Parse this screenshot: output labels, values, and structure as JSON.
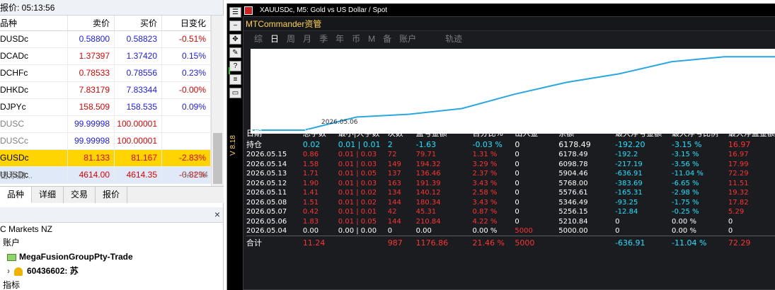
{
  "market_watch": {
    "title": "报价: 05:13:56",
    "headers": {
      "symbol": "品种",
      "bid": "卖价",
      "ask": "买价",
      "change": "日变化"
    },
    "rows": [
      {
        "symbol": "DUSDc",
        "bid": "0.58800",
        "ask": "0.58823",
        "change": "-0.51%",
        "state": ""
      },
      {
        "symbol": "DCADc",
        "bid": "1.37397",
        "ask": "1.37420",
        "change": "0.15%",
        "state": ""
      },
      {
        "symbol": "DCHFc",
        "bid": "0.78533",
        "ask": "0.78556",
        "change": "0.23%",
        "state": ""
      },
      {
        "symbol": "DHKDc",
        "bid": "7.83179",
        "ask": "7.83344",
        "change": "-0.00%",
        "state": ""
      },
      {
        "symbol": "DJPYc",
        "bid": "158.509",
        "ask": "158.535",
        "change": "0.09%",
        "state": ""
      },
      {
        "symbol": "DUSC",
        "bid": "99.99998",
        "ask": "100.00001",
        "change": "",
        "state": "gray"
      },
      {
        "symbol": "DUSCc",
        "bid": "99.99998",
        "ask": "100.00001",
        "change": "",
        "state": "gray"
      },
      {
        "symbol": "GUSDc",
        "bid": "81.133",
        "ask": "81.167",
        "change": "-2.83%",
        "state": "highlight"
      },
      {
        "symbol": "UUSDc",
        "bid": "4614.00",
        "ask": "4614.35",
        "change": "-0.82%",
        "state": "selected"
      }
    ],
    "footer_add": "击添加...",
    "footer_count": "34 / 34",
    "tabs": [
      "品种",
      "详细",
      "交易",
      "报价"
    ]
  },
  "navigator": {
    "broker": "C Markets NZ",
    "accounts_label": "账户",
    "server": "MegaFusionGroupPty-Trade",
    "account": "60436602: 苏",
    "indicators": "指标",
    "close_icon": "close-icon"
  },
  "chart": {
    "title": "XAUUSDc, M5:  Gold vs US Dollar / Spot",
    "side_label": "V 8.18",
    "panel_title": "MTCommander资管",
    "period_tabs": [
      "综",
      "日",
      "周",
      "月",
      "季",
      "年",
      "币",
      "M",
      "备",
      "账户",
      "",
      "轨迹"
    ],
    "active_tab": "日",
    "equity_date": "2026.05.06",
    "equity_series": [
      5000,
      5000,
      5210.84,
      5256.15,
      5346.49,
      5576.61,
      5768.0,
      5904.46,
      6098.78,
      6178.49,
      6178.49
    ],
    "line_color": "#29a8e0",
    "table": {
      "headers": [
        "日期",
        "总手数",
        "最小|大手数",
        "次数",
        "盈亏金额",
        "百分比%",
        "出入金",
        "余额",
        "最大浮亏金额",
        "最大浮亏比例",
        "最大浮盈金额"
      ],
      "position_row": [
        "持仓",
        "0.02",
        "0.01 | 0.01",
        "2",
        "-1.63",
        "-0.03 %",
        "0",
        "6178.49",
        "-192.20",
        "-3.15 %",
        "16.97"
      ],
      "rows": [
        [
          "2026.05.15",
          "0.86",
          "0.01 | 0.03",
          "72",
          "79.71",
          "1.31 %",
          "0",
          "6178.49",
          "-192.2",
          "-3.15 %",
          "16.97"
        ],
        [
          "2026.05.14",
          "1.58",
          "0.01 | 0.03",
          "149",
          "194.32",
          "3.29 %",
          "0",
          "6098.78",
          "-217.19",
          "-3.56 %",
          "17.99"
        ],
        [
          "2026.05.13",
          "1.71",
          "0.01 | 0.05",
          "137",
          "136.46",
          "2.37 %",
          "0",
          "5904.46",
          "-636.91",
          "-11.04 %",
          "72.29"
        ],
        [
          "2026.05.12",
          "1.90",
          "0.01 | 0.03",
          "163",
          "191.39",
          "3.43 %",
          "0",
          "5768.00",
          "-383.69",
          "-6.65 %",
          "11.51"
        ],
        [
          "2026.05.11",
          "1.41",
          "0.01 | 0.02",
          "134",
          "140.12",
          "2.58 %",
          "0",
          "5576.61",
          "-165.31",
          "-2.98 %",
          "19.32"
        ],
        [
          "2026.05.08",
          "1.51",
          "0.01 | 0.02",
          "144",
          "180.34",
          "3.43 %",
          "0",
          "5346.49",
          "-93.25",
          "-1.75 %",
          "17.82"
        ],
        [
          "2026.05.07",
          "0.42",
          "0.01 | 0.01",
          "42",
          "45.31",
          "0.87 %",
          "0",
          "5256.15",
          "-12.84",
          "-0.25 %",
          "5.29"
        ],
        [
          "2026.05.06",
          "1.83",
          "0.01 | 0.05",
          "144",
          "210.84",
          "4.22 %",
          "0",
          "5210.84",
          "0",
          "0.00 %",
          "0"
        ],
        [
          "2026.05.04",
          "0.00",
          "0.00 | 0.00",
          "0",
          "0.00",
          "0.00 %",
          "5000",
          "5000.00",
          "0",
          "0.00 %",
          "0"
        ]
      ],
      "total_row": [
        "合计",
        "11.24",
        "",
        "987",
        "1176.86",
        "21.46 %",
        "5000",
        "",
        "-636.91",
        "-11.04 %",
        "72.29"
      ]
    }
  }
}
